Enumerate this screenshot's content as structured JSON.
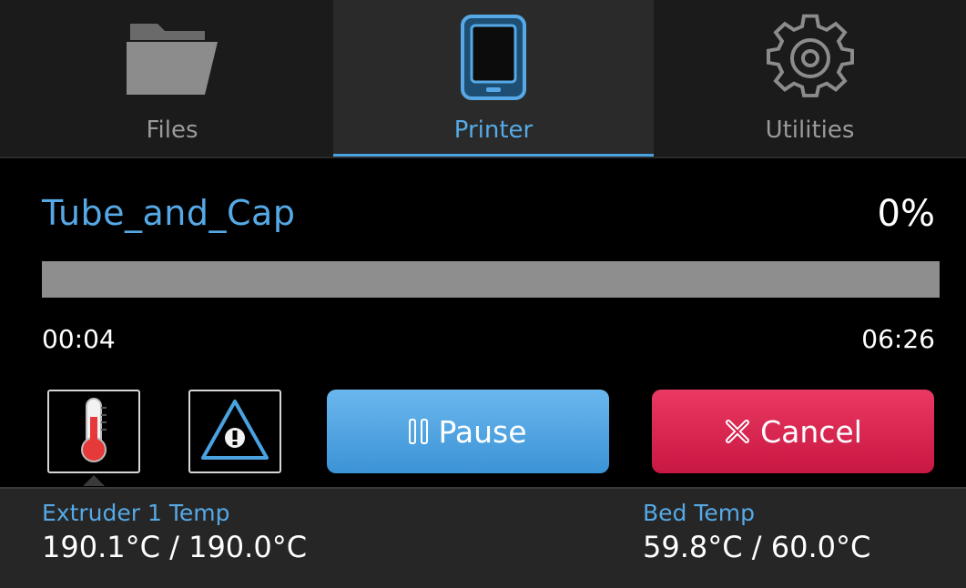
{
  "tabs": [
    {
      "label": "Files",
      "icon": "folder-icon",
      "active": false
    },
    {
      "label": "Printer",
      "icon": "printer-icon",
      "active": true
    },
    {
      "label": "Utilities",
      "icon": "gear-icon",
      "active": false
    }
  ],
  "job": {
    "name": "Tube_and_Cap",
    "percent_label": "0%",
    "progress": 0,
    "elapsed": "00:04",
    "total": "06:26"
  },
  "controls": {
    "temperature_icon": "thermometer-icon",
    "alert_icon": "warning-icon",
    "pause_label": "Pause",
    "cancel_label": "Cancel"
  },
  "temps": {
    "extruder_title": "Extruder 1 Temp",
    "extruder_value": "190.1°C / 190.0°C",
    "bed_title": "Bed Temp",
    "bed_value": "59.8°C / 60.0°C"
  },
  "colors": {
    "accent": "#56a9e6",
    "cancel": "#d4204c",
    "progress_track": "#8e8e8e"
  }
}
